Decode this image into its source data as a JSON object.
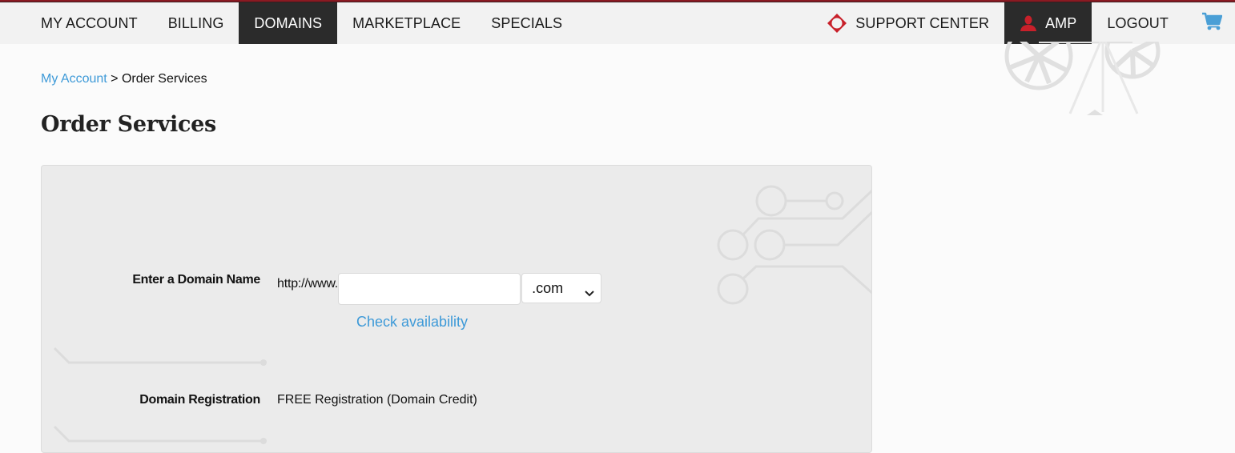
{
  "nav": {
    "left": [
      {
        "label": "MY ACCOUNT",
        "active": false
      },
      {
        "label": "BILLING",
        "active": false
      },
      {
        "label": "DOMAINS",
        "active": true
      },
      {
        "label": "MARKETPLACE",
        "active": false
      },
      {
        "label": "SPECIALS",
        "active": false
      }
    ],
    "support": {
      "label": "SUPPORT CENTER",
      "icon": "support-lifebuoy-icon"
    },
    "user": {
      "label": "AMP",
      "icon": "user-icon"
    },
    "logout": {
      "label": "LOGOUT"
    },
    "cart": {
      "icon": "shopping-cart-icon"
    }
  },
  "breadcrumb": {
    "parent": "My Account",
    "separator": ">",
    "current": "Order Services"
  },
  "page": {
    "title": "Order Services"
  },
  "form": {
    "domain": {
      "label": "Enter a Domain Name",
      "prefix": "http://www.",
      "value": "",
      "placeholder": "",
      "tld_selected": ".com",
      "check_link": "Check availability"
    },
    "registration": {
      "label": "Domain Registration",
      "value": "FREE Registration (Domain Credit)"
    }
  },
  "colors": {
    "accent_link": "#3e9ad8",
    "brand_red": "#c8202a",
    "nav_active_bg": "#2b2b2b",
    "cart_blue": "#4a9fd6"
  }
}
